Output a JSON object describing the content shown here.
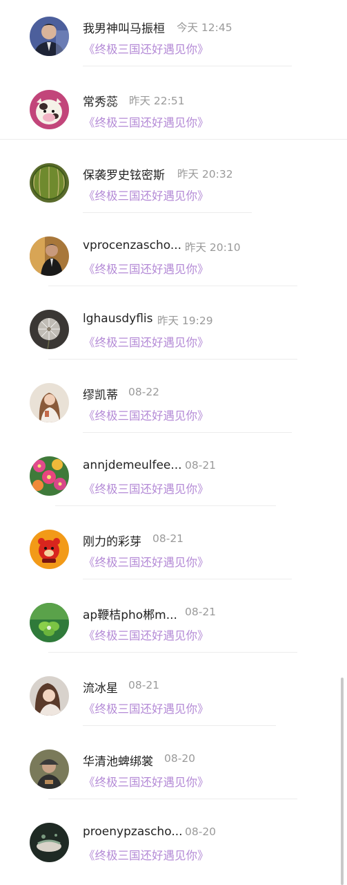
{
  "conversations": [
    {
      "name": "我男神叫马振桓",
      "time": "今天 12:45",
      "message": "《终极三国还好遇见你》",
      "avatar_icon": "man-in-suit-photo-icon"
    },
    {
      "name": "常秀蕊",
      "time": "昨天 22:51",
      "message": "《终极三国还好遇见你》",
      "avatar_icon": "cartoon-cow-avatar-icon"
    },
    {
      "name": "保袭罗史铉密斯",
      "time": "昨天 20:32",
      "message": "《终极三国还好遇见你》",
      "avatar_icon": "cactus-photo-icon"
    },
    {
      "name": "vprocenzascho...",
      "time": "昨天 20:10",
      "message": "《终极三国还好遇见你》",
      "avatar_icon": "man-portrait-photo-icon"
    },
    {
      "name": "lghausdyflis",
      "time": "昨天 19:29",
      "message": "《终极三国还好遇见你》",
      "avatar_icon": "dandelion-photo-icon"
    },
    {
      "name": "缪凯蒂",
      "time": "08-22",
      "message": "《终极三国还好遇见你》",
      "avatar_icon": "woman-portrait-photo-icon"
    },
    {
      "name": "annjdemeulfee...",
      "time": "08-21",
      "message": "《终极三国还好遇见你》",
      "avatar_icon": "flowers-photo-icon"
    },
    {
      "name": "刚力的彩芽",
      "time": "08-21",
      "message": "《终极三国还好遇见你》",
      "avatar_icon": "cartoon-bear-avatar-icon"
    },
    {
      "name": "ap鞭桔pho郴m...",
      "time": "08-21",
      "message": "《终极三国还好遇见你》",
      "avatar_icon": "clover-photo-icon"
    },
    {
      "name": "流冰星",
      "time": "08-21",
      "message": "《终极三国还好遇见你》",
      "avatar_icon": "girl-portrait-photo-icon"
    },
    {
      "name": "华清池蜱绑裳",
      "time": "08-20",
      "message": "《终极三国还好遇见你》",
      "avatar_icon": "man-with-cap-photo-icon"
    },
    {
      "name": "proenypzascho...",
      "time": "08-20",
      "message": "《终极三国还好遇见你》",
      "avatar_icon": "dark-scene-photo-icon"
    }
  ],
  "colors": {
    "name_text": "#222222",
    "time_text": "#9a9a9a",
    "message_text": "#b48ad6",
    "divider": "#ececec"
  }
}
